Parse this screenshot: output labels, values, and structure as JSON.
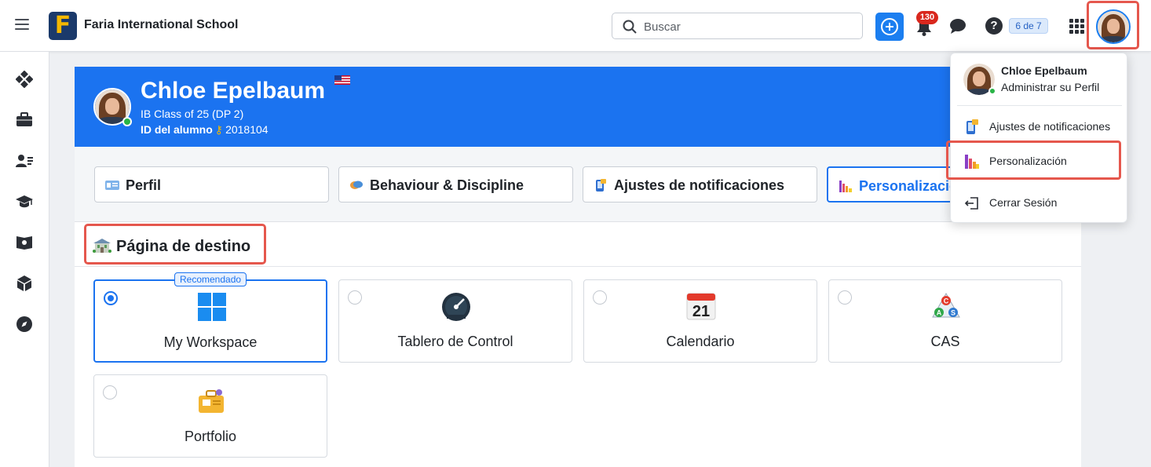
{
  "topbar": {
    "school_name": "Faria International School",
    "logo_letter": "F",
    "search_placeholder": "Buscar",
    "notification_count": "130",
    "pager": "6 de 7"
  },
  "profile": {
    "name": "Chloe Epelbaum",
    "class": "IB Class of 25 (DP 2)",
    "id_label": "ID del alumno",
    "id_value": "2018104"
  },
  "tabs": [
    {
      "label": "Perfil"
    },
    {
      "label": "Behaviour & Discipline"
    },
    {
      "label": "Ajustes de notificaciones"
    },
    {
      "label": "Personalización"
    }
  ],
  "landing": {
    "title": "Página de destino",
    "recommended": "Recomendado",
    "options": [
      {
        "label": "My Workspace",
        "selected": true
      },
      {
        "label": "Tablero de Control",
        "selected": false
      },
      {
        "label": "Calendario",
        "selected": false
      },
      {
        "label": "CAS",
        "selected": false
      },
      {
        "label": "Portfolio",
        "selected": false
      }
    ],
    "calendar_day": "21",
    "cas_letters": [
      "C",
      "A",
      "S"
    ]
  },
  "dropdown": {
    "name": "Chloe Epelbaum",
    "subtitle": "Administrar su Perfil",
    "items": [
      {
        "label": "Ajustes de notificaciones"
      },
      {
        "label": "Personalización"
      },
      {
        "label": "Cerrar Sesión"
      }
    ]
  },
  "colors": {
    "primary": "#1b73f0",
    "highlight": "#e5574d",
    "badge": "#d9271d",
    "online": "#28b446"
  }
}
